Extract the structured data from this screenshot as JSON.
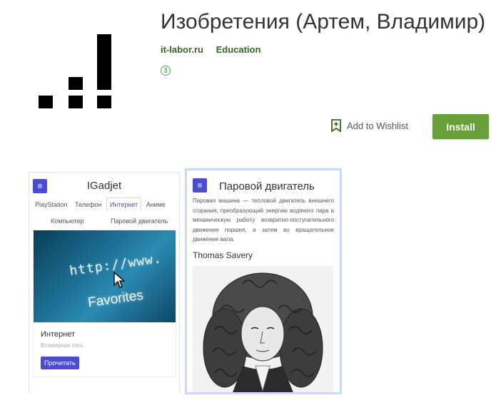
{
  "app": {
    "title": "Изобретения (Артем, Владимир)",
    "developer": "it-labor.ru",
    "category": "Education",
    "rating_badge": "3",
    "wishlist_label": "Add to Wishlist",
    "install_label": "Install",
    "accent_color": "#689f38",
    "developer_color": "#33691e"
  },
  "screenshot1": {
    "title": "IGadjet",
    "menu_icon": "≡",
    "tabs": [
      "PlayStation",
      "Телефон",
      "Интернет",
      "Аниме"
    ],
    "tabs_row2": [
      "Компьютер",
      "Паровой двигатель"
    ],
    "card": {
      "image_url_text": "http://www.",
      "image_favorites_text": "Favorites",
      "title": "Интернет",
      "subtitle": "Всемирная сеть",
      "button": "Прочитать"
    }
  },
  "screenshot2": {
    "menu_icon": "≡",
    "title": "Паровой двигатель",
    "text": "Паровая машина — тепловой двигатель внешнего сгорания, преобразующий энергию водяного пара в механическую работу возвратно-поступательного движения поршня, а затем во вращательное движение вала.",
    "person_name": "Thomas Savery"
  }
}
